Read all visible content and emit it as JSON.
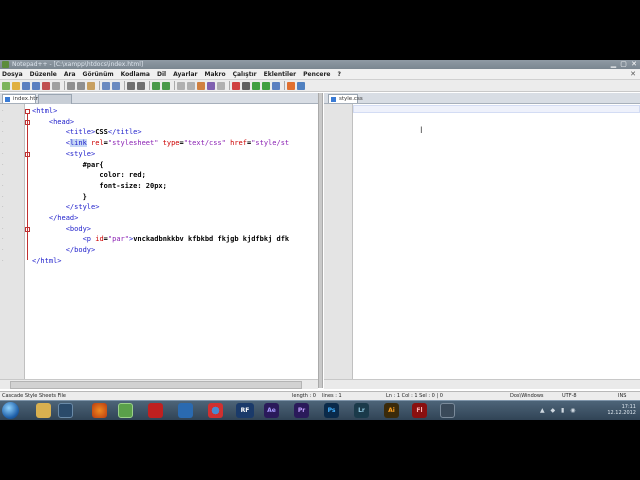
{
  "window": {
    "title": "Notepad++ - [C:\\xampp\\htdocs\\index.html]"
  },
  "menu": [
    "Dosya",
    "Düzenle",
    "Ara",
    "Görünüm",
    "Kodlama",
    "Dil",
    "Ayarlar",
    "Makro",
    "Çalıştır",
    "Eklentiler",
    "Pencere",
    "?"
  ],
  "tabs_left": [
    {
      "label": "index.html"
    }
  ],
  "tabs_right": [
    {
      "label": "style.css"
    }
  ],
  "code_lines": [
    {
      "parts": [
        {
          "c": "tag",
          "t": "<html>"
        }
      ]
    },
    {
      "parts": [
        {
          "c": "tag",
          "t": "    <head>"
        }
      ]
    },
    {
      "parts": [
        {
          "c": "tag",
          "t": "        <title>"
        },
        {
          "c": "txt",
          "t": "CSS"
        },
        {
          "c": "tag",
          "t": "</title>"
        }
      ]
    },
    {
      "parts": [
        {
          "c": "tag",
          "t": "        <"
        },
        {
          "c": "tag hl",
          "t": "link"
        },
        {
          "c": "attr",
          "t": " rel"
        },
        {
          "c": "txt",
          "t": "="
        },
        {
          "c": "val",
          "t": "\"stylesheet\""
        },
        {
          "c": "attr",
          "t": " type"
        },
        {
          "c": "txt",
          "t": "="
        },
        {
          "c": "val",
          "t": "\"text/css\""
        },
        {
          "c": "attr",
          "t": " href"
        },
        {
          "c": "txt",
          "t": "="
        },
        {
          "c": "val",
          "t": "\"style/st"
        }
      ]
    },
    {
      "parts": [
        {
          "c": "tag",
          "t": "        <style>"
        }
      ]
    },
    {
      "parts": [
        {
          "c": "txt",
          "t": "            #par{"
        }
      ]
    },
    {
      "parts": [
        {
          "c": "txt",
          "t": "                color: red;"
        }
      ]
    },
    {
      "parts": [
        {
          "c": "txt",
          "t": "                font-size: 20px;"
        }
      ]
    },
    {
      "parts": [
        {
          "c": "txt",
          "t": "            }"
        }
      ]
    },
    {
      "parts": [
        {
          "c": "tag",
          "t": "        </style>"
        }
      ]
    },
    {
      "parts": [
        {
          "c": "tag",
          "t": "    </head>"
        }
      ]
    },
    {
      "parts": [
        {
          "c": "tag",
          "t": "        <body>"
        }
      ]
    },
    {
      "parts": [
        {
          "c": "tag",
          "t": "            <p"
        },
        {
          "c": "attr",
          "t": " id"
        },
        {
          "c": "txt",
          "t": "="
        },
        {
          "c": "val",
          "t": "\"par\""
        },
        {
          "c": "tag",
          "t": ">"
        },
        {
          "c": "txt",
          "t": "vnckadbnkkbv kfbkbd fkjgb kjdfbkj dfk"
        }
      ]
    },
    {
      "parts": [
        {
          "c": "tag",
          "t": "        </body>"
        }
      ]
    },
    {
      "parts": [
        {
          "c": "tag",
          "t": "</html>"
        }
      ]
    }
  ],
  "status": {
    "file_type": "Cascade Style Sheets File",
    "length": "length : 0",
    "lines": "lines : 1",
    "position": "Ln : 1    Col : 1    Sel : 0 | 0",
    "eol": "Dos\\Windows",
    "encoding": "UTF-8",
    "mode": "INS"
  },
  "taskbar": {
    "apps": [
      "explorer",
      "firefox",
      "notepad++",
      "filezilla",
      "media",
      "chrome",
      "RF",
      "Ae",
      "Pr",
      "Ps",
      "Lr",
      "Ai",
      "Fl",
      "recorder"
    ],
    "labels": {
      "rf": "RF",
      "ae": "Ae",
      "pr": "Pr",
      "ps": "Ps",
      "lr": "Lr",
      "ai": "Ai",
      "fl": "Fl"
    },
    "clock_time": "17:11",
    "clock_date": "12.12.2012"
  },
  "colors": {
    "tag": "#2222cc",
    "attr": "#cc0000",
    "value": "#8a1fb3"
  }
}
